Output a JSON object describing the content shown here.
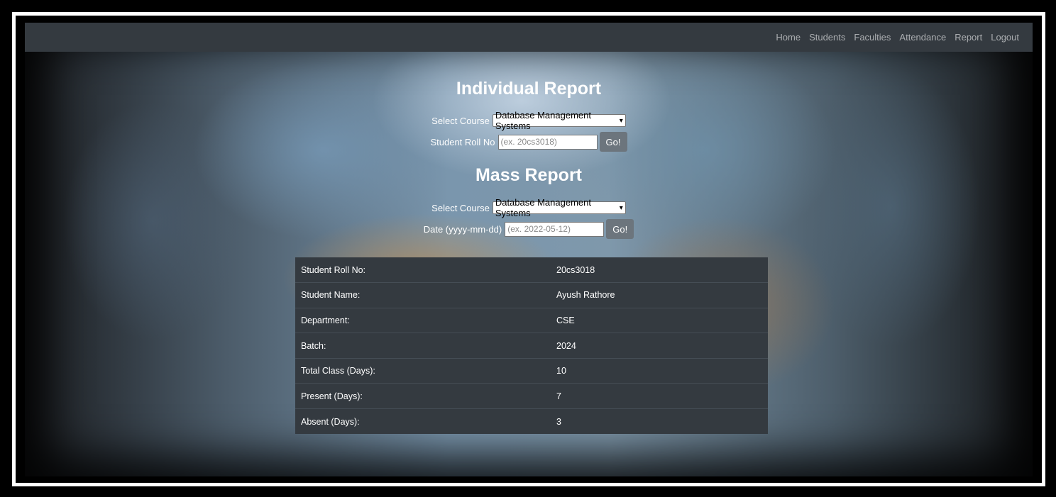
{
  "navbar": {
    "links": [
      "Home",
      "Students",
      "Faculties",
      "Attendance",
      "Report",
      "Logout"
    ]
  },
  "individual_report": {
    "title": "Individual Report",
    "course_label": "Select Course",
    "course_selected": "Database Management Systems",
    "roll_label": "Student Roll No",
    "roll_placeholder": "(ex. 20cs3018)",
    "go_label": "Go!"
  },
  "mass_report": {
    "title": "Mass Report",
    "course_label": "Select Course",
    "course_selected": "Database Management Systems",
    "date_label": "Date (yyyy-mm-dd)",
    "date_placeholder": "(ex. 2022-05-12)",
    "go_label": "Go!"
  },
  "report": {
    "rows": [
      {
        "label": "Student Roll No:",
        "value": "20cs3018"
      },
      {
        "label": "Student Name:",
        "value": "Ayush Rathore"
      },
      {
        "label": "Department:",
        "value": "CSE"
      },
      {
        "label": "Batch:",
        "value": "2024"
      },
      {
        "label": "Total Class (Days):",
        "value": "10"
      },
      {
        "label": "Present (Days):",
        "value": "7"
      },
      {
        "label": "Absent (Days):",
        "value": "3"
      }
    ]
  },
  "colors": {
    "navbar": "#343a40",
    "table": "#343a40",
    "button": "#6c757d"
  }
}
